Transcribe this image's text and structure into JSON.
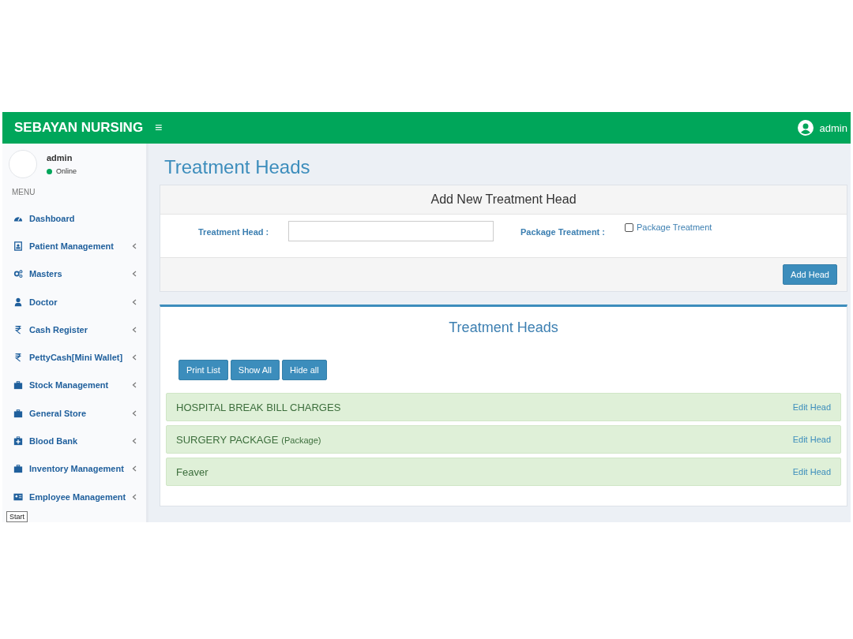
{
  "header": {
    "brand": "SEBAYAN NURSING",
    "menu_toggle": "≡",
    "user": "admin"
  },
  "user_panel": {
    "name": "admin",
    "status": "Online",
    "online": true
  },
  "sidebar": {
    "heading": "MENU",
    "items": [
      {
        "label": "Dashboard",
        "kind": "dashboard",
        "expandable": false
      },
      {
        "label": "Patient Management",
        "kind": "patient",
        "expandable": true
      },
      {
        "label": "Masters",
        "kind": "masters",
        "expandable": true
      },
      {
        "label": "Doctor",
        "kind": "doctor",
        "expandable": true
      },
      {
        "label": "Cash Register",
        "kind": "rupee",
        "expandable": true
      },
      {
        "label": "PettyCash[Mini Wallet]",
        "kind": "rupee",
        "expandable": true
      },
      {
        "label": "Stock Management",
        "kind": "briefcase",
        "expandable": true
      },
      {
        "label": "General Store",
        "kind": "briefcase",
        "expandable": true
      },
      {
        "label": "Blood Bank",
        "kind": "medkit",
        "expandable": true
      },
      {
        "label": "Inventory Management",
        "kind": "briefcase",
        "expandable": true
      },
      {
        "label": "Employee Management",
        "kind": "idcard",
        "expandable": true
      }
    ]
  },
  "tooltip": "Start",
  "page_title": "Treatment Heads",
  "form": {
    "title": "Add New Treatment Head",
    "head_label": "Treatment Head :",
    "package_label": "Package Treatment :",
    "package_checkbox": {
      "label": "Package Treatment",
      "checked": false
    },
    "submit": "Add Head"
  },
  "list": {
    "title": "Treatment Heads",
    "buttons": [
      "Print List",
      "Show All",
      "Hide all"
    ],
    "rows": [
      {
        "name": "HOSPITAL BREAK BILL CHARGES",
        "action": "Edit Head"
      },
      {
        "name": "SURGERY PACKAGE",
        "tag": "(Package)",
        "action": "Edit Head"
      },
      {
        "name": "Feaver",
        "action": "Edit Head"
      }
    ]
  }
}
